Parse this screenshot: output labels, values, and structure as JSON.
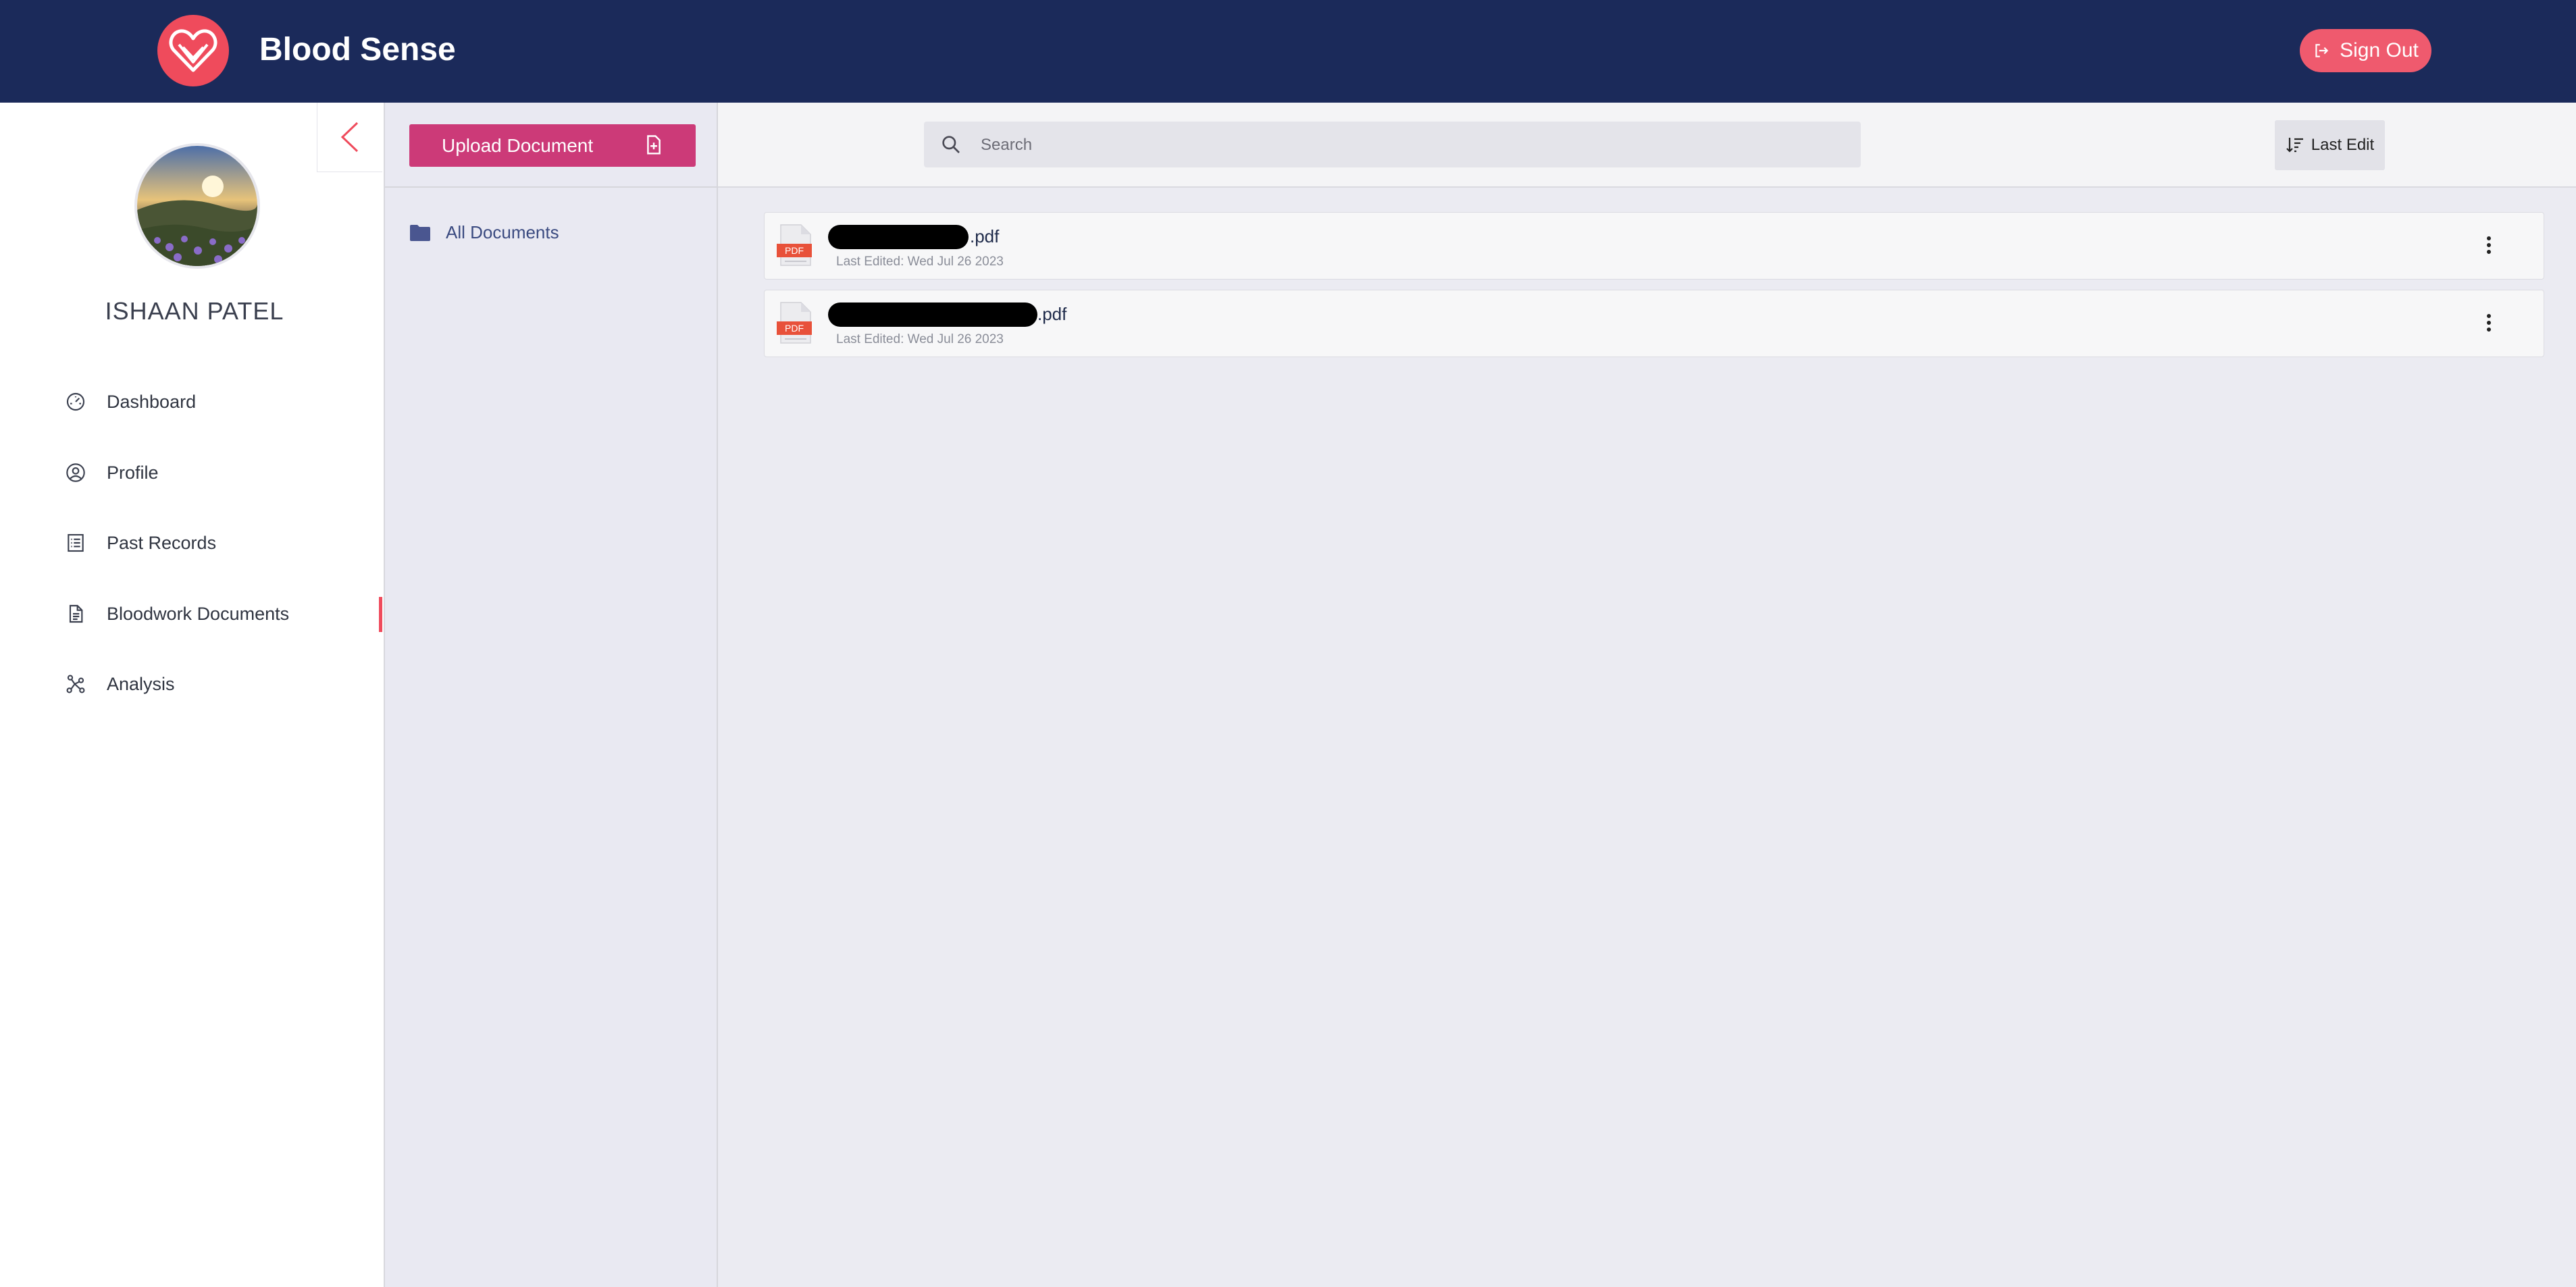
{
  "header": {
    "app_title": "Blood Sense",
    "signout_label": "Sign Out"
  },
  "sidebar": {
    "user_name": "ISHAAN PATEL",
    "items": [
      {
        "label": "Dashboard",
        "icon": "dashboard-icon"
      },
      {
        "label": "Profile",
        "icon": "user-circle-icon"
      },
      {
        "label": "Past Records",
        "icon": "list-icon"
      },
      {
        "label": "Bloodwork Documents",
        "icon": "document-icon",
        "active": true
      },
      {
        "label": "Analysis",
        "icon": "network-icon"
      }
    ]
  },
  "folders": {
    "upload_label": "Upload Document",
    "items": [
      {
        "label": "All Documents",
        "icon": "folder-icon"
      }
    ]
  },
  "toolbar": {
    "search_placeholder": "Search",
    "sort_label": "Last Edit"
  },
  "documents": [
    {
      "name_suffix": ".pdf",
      "meta": "Last Edited: Wed Jul 26 2023"
    },
    {
      "name_suffix": ".pdf",
      "meta": "Last Edited: Wed Jul 26 2023"
    }
  ],
  "colors": {
    "header_bg": "#1b2a5a",
    "accent": "#ef4b5c",
    "upload_button": "#cc3a78"
  }
}
